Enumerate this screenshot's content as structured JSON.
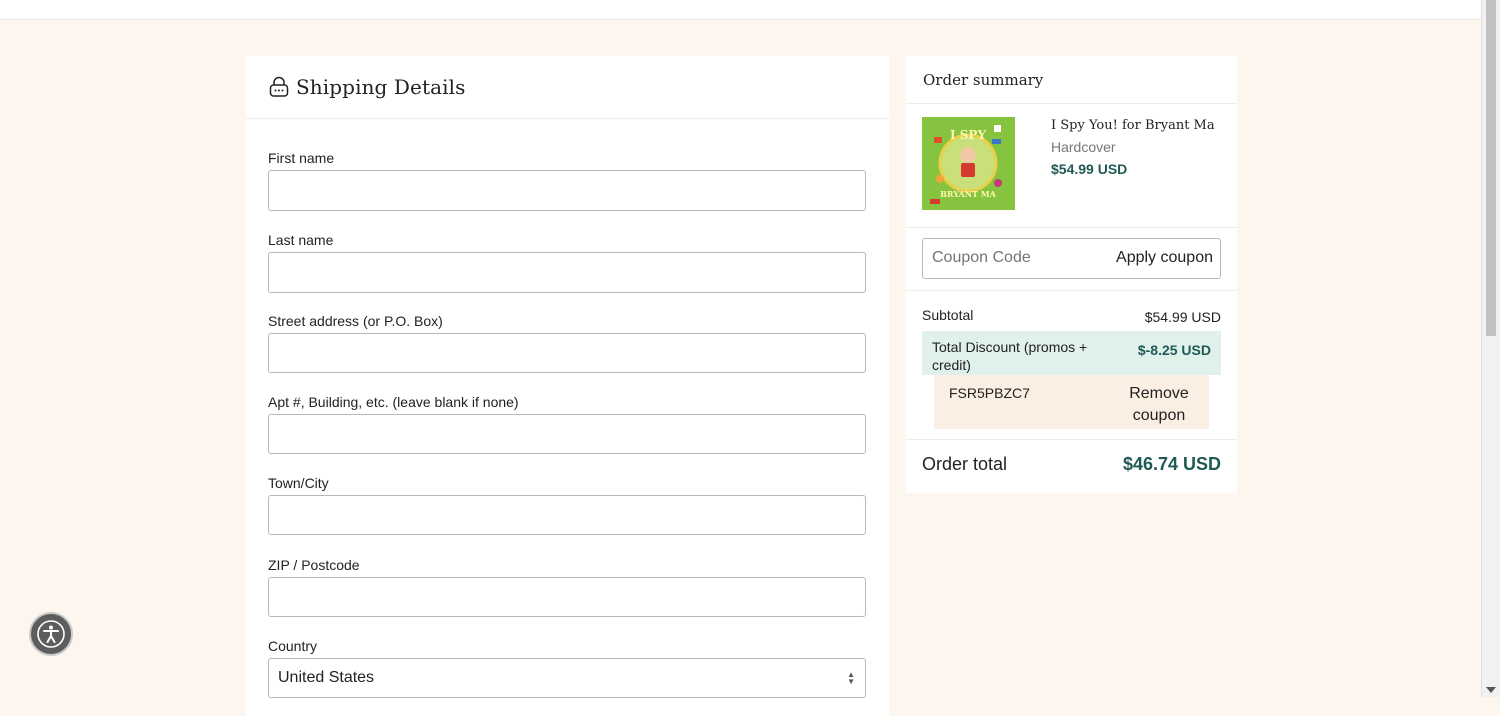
{
  "shipping": {
    "title": "Shipping Details",
    "fields": [
      {
        "label": "First name",
        "value": ""
      },
      {
        "label": "Last name",
        "value": ""
      },
      {
        "label": "Street address (or P.O. Box)",
        "value": ""
      },
      {
        "label": "Apt #, Building, etc. (leave blank if none)",
        "value": ""
      },
      {
        "label": "Town/City",
        "value": ""
      },
      {
        "label": "ZIP / Postcode",
        "value": ""
      }
    ],
    "country": {
      "label": "Country",
      "value": "United States"
    }
  },
  "summary": {
    "title": "Order summary",
    "item": {
      "name": "I Spy You! for Bryant Ma",
      "format": "Hardcover",
      "price": "$54.99 USD",
      "cover_text_top": "I SPY",
      "cover_text_bottom": "BRYANT MA"
    },
    "coupon": {
      "placeholder": "Coupon Code",
      "apply_label": "Apply coupon"
    },
    "subtotal_label": "Subtotal",
    "subtotal_value": "$54.99 USD",
    "discount_label": "Total Discount (promos + credit)",
    "discount_value": "$-8.25 USD",
    "applied_code": "FSR5PBZC7",
    "remove_label": "Remove coupon",
    "order_total_label": "Order total",
    "order_total_value": "$46.74 USD"
  },
  "colors": {
    "accent": "#1f5a55",
    "page_bg": "#fdf6ef",
    "discount_bg": "#e0f1ec"
  },
  "icons": {
    "shipping": "lock-icon",
    "accessibility": "accessibility-icon"
  }
}
